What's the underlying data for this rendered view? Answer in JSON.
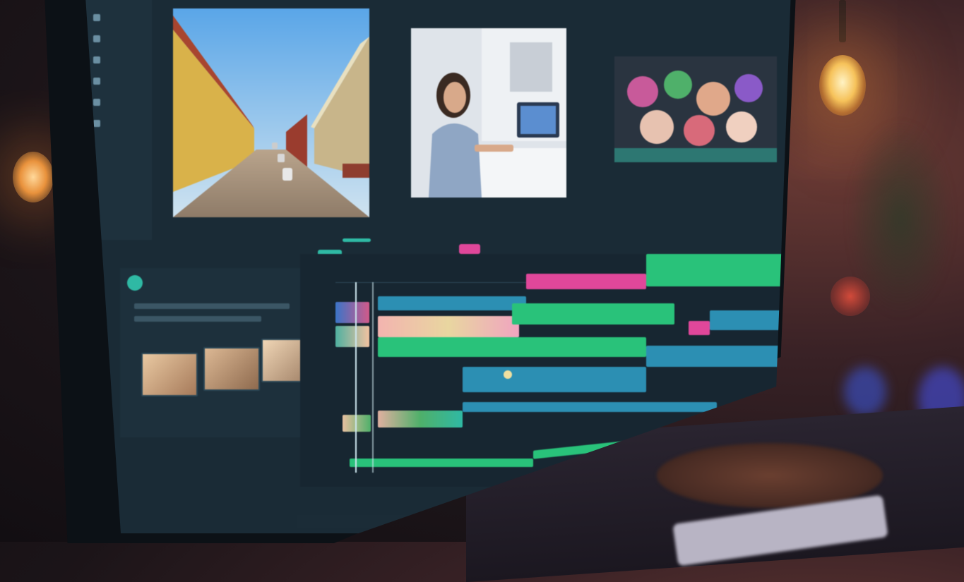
{
  "scene": {
    "description_tags": [
      "desk",
      "computer-monitor",
      "video-editing-software"
    ],
    "colors": {
      "accent_teal": "#2fb9a4",
      "clip_green": "#29c27a",
      "clip_blue": "#2c8fb3",
      "clip_pink": "#e0479a",
      "screen_bg": "#1a2b36"
    }
  },
  "editor": {
    "sidebar": {
      "items": [
        "",
        "",
        "",
        "",
        "",
        ""
      ]
    },
    "preview_labels": [
      "",
      "",
      ""
    ],
    "timeline": {
      "track_labels": [
        "",
        "",
        "",
        "",
        "",
        "",
        "",
        "",
        ""
      ]
    },
    "media": {
      "title": "",
      "thumb_labels": [
        "",
        "",
        ""
      ]
    }
  }
}
